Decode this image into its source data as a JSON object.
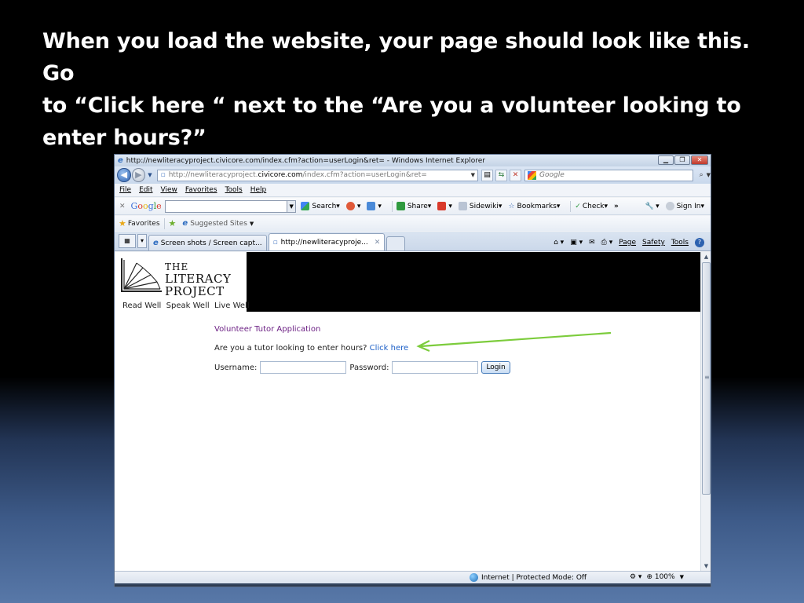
{
  "slide": {
    "line1": "When you load the website, your page should look like this.  Go",
    "line2": "to “Click here “ next to the “Are you a volunteer looking to",
    "line3": "enter hours?”"
  },
  "browser": {
    "window_title": "http://newliteracyproject.civicore.com/index.cfm?action=userLogin&ret= - Windows Internet Explorer",
    "url_prefix": "http://newliteracyproject.",
    "url_domain": "civicore.com",
    "url_rest": "/index.cfm?action=userLogin&ret=",
    "search_placeholder": "Google",
    "menu": [
      "File",
      "Edit",
      "View",
      "Favorites",
      "Tools",
      "Help"
    ],
    "google_toolbar": {
      "logo": [
        "G",
        "o",
        "o",
        "g",
        "l",
        "e"
      ],
      "search_label": "Search",
      "share_label": "Share",
      "sidewiki_label": "Sidewiki",
      "bookmarks_label": "Bookmarks",
      "check_label": "Check",
      "more_label": "»",
      "signin_label": "Sign In"
    },
    "favorites": {
      "favorites_label": "Favorites",
      "suggested_label": "Suggested Sites"
    },
    "tabs": [
      {
        "label": "Screen shots / Screen capt..."
      },
      {
        "label": "http://newliteracyproje..."
      }
    ],
    "command_bar": {
      "page_label": "Page",
      "safety_label": "Safety",
      "tools_label": "Tools"
    },
    "status": {
      "zone": "Internet | Protected Mode: Off",
      "zoom": "100%"
    }
  },
  "site": {
    "logo_line1": "THE",
    "logo_line2": "LITERACY",
    "logo_line3": "PROJECT",
    "tagline": "Read Well  Speak Well  Live Well",
    "app_title": "Volunteer Tutor Application",
    "tutor_question": "Are you a tutor looking to enter hours?",
    "click_here": "Click here",
    "username_label": "Username:",
    "password_label": "Password:",
    "login_button": "Login"
  },
  "colors": {
    "arrow": "#7ccc3c",
    "link": "#1c5fc7",
    "app_title": "#6b1f83"
  }
}
